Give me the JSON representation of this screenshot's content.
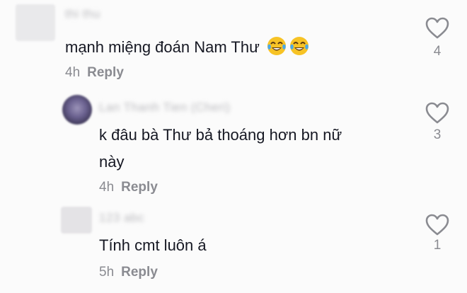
{
  "comments": [
    {
      "username": "thi thu",
      "text": "mạnh miệng đoán Nam Thư",
      "emojis": [
        "tears-of-joy-emoji",
        "tears-of-joy-emoji"
      ],
      "time": "4h",
      "reply_label": "Reply",
      "likes": "4"
    },
    {
      "username": "Lan Thanh Tien (Cheri)",
      "text_line1": "k đâu bà Thư bả thoáng hơn bn nữ",
      "text_line2": "này",
      "time": "4h",
      "reply_label": "Reply",
      "likes": "3"
    },
    {
      "username": "123 abc",
      "text": "Tính cmt luôn á",
      "time": "5h",
      "reply_label": "Reply",
      "likes": "1"
    }
  ],
  "colors": {
    "background": "#fbfbfb",
    "text": "#161823",
    "muted": "#8a8b91",
    "heart_outline": "#8a8b91"
  }
}
